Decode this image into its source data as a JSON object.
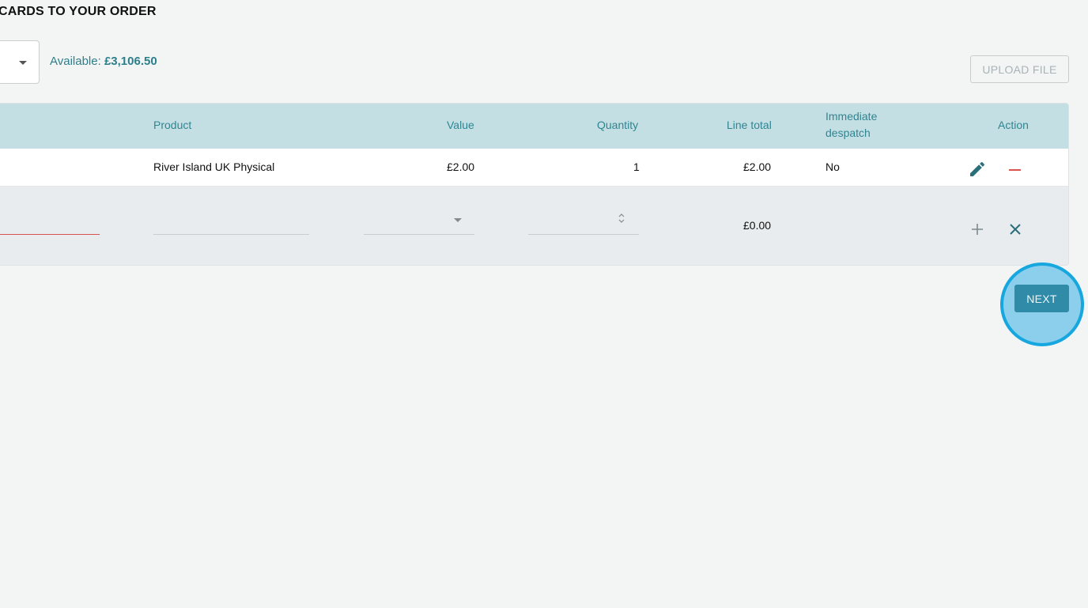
{
  "section": {
    "title": "CARDS TO YOUR ORDER"
  },
  "account": {
    "available_label": "Available:",
    "available_amount": "£3,106.50"
  },
  "toolbar": {
    "upload_label": "UPLOAD FILE"
  },
  "table": {
    "headers": {
      "product": "Product",
      "value": "Value",
      "quantity": "Quantity",
      "line_total": "Line total",
      "immediate_line1": "Immediate",
      "immediate_line2": "despatch",
      "action": "Action"
    },
    "rows": [
      {
        "product": "River Island UK Physical",
        "value": "£2.00",
        "quantity": "1",
        "line_total": "£2.00",
        "immediate": "No"
      }
    ],
    "new_row": {
      "line_total": "£0.00"
    }
  },
  "actions": {
    "next_label": "NEXT"
  },
  "icons": {
    "edit": "pencil-icon",
    "remove": "minus-icon",
    "add": "plus-icon",
    "cancel": "close-icon"
  },
  "colors": {
    "accent": "#2f8592",
    "header_bg": "#c4dfe3",
    "error": "#d9534f",
    "next_bg": "#2f8ba8"
  }
}
